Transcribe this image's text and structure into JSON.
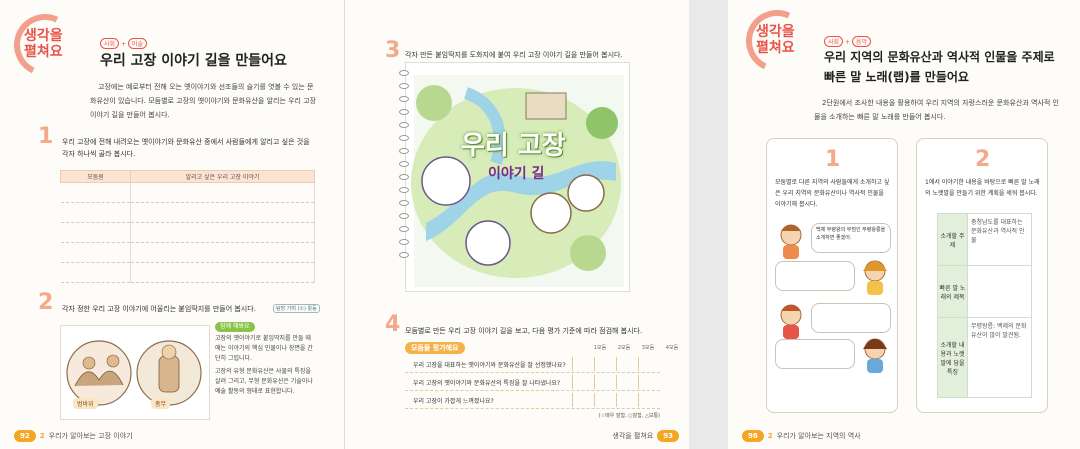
{
  "left_page": {
    "badge": "생각을\n펼쳐요",
    "subjects": [
      "사회",
      "미술"
    ],
    "title": "우리 고장 이야기 길을 만들어요",
    "intro": "고장에는 예로부터 전해 오는 옛이야기와 선조들의 슬기를 엿볼 수 있는 문화유산이 있습니다. 모둠별로 고장의 옛이야기와 문화유산을 알리는 우리 고장 이야기 길을 만들어 봅시다.",
    "step1_num": "1",
    "step1_text": "우리 고장에 전해 내려오는 옛이야기와 문화유산 중에서 사람들에게 알리고 싶은 것을 각자 하나씩 골라 봅시다.",
    "table_headers": [
      "모둠원",
      "알리고 싶은 우리 고장 이야기"
    ],
    "table_rows": 5,
    "step2_num": "2",
    "step2_text": "각자 정한 우리 고장 이야기에 어울리는 붙임딱지를 만들어 봅시다.",
    "step2_tag": "탐방 가며 (①) 활동",
    "stamp_labels": [
      "범바위",
      "총무"
    ],
    "note_title": "함께 해봐요",
    "note_items": [
      "고장의 옛이야기로 붙임딱지를 만들 때에는 이야기의 핵심 인물이나 장면을 간단히 그립니다.",
      "고장의 유형 문화유산은 사물의 특징을 살려 그리고, 무형 문화유산은 기술이나 예술 활동의 형태로 표현합니다."
    ],
    "footer_page": "92",
    "footer_unit": "2",
    "footer_text": "우리가 알아보는 고장 이야기"
  },
  "right_page": {
    "step3_num": "3",
    "step3_text": "각자 만든 붙임딱지를 도화지에 붙여 우리 고장 이야기 길을 만들어 봅시다.",
    "map_title": "우리 고장",
    "map_sub": "이야기 길",
    "step4_num": "4",
    "step4_text": "모둠별로 만든 우리 고장 이야기 길을 보고, 다음 평가 기준에 따라 점검해 봅시다.",
    "eval_label": "모둠들 평가해요",
    "eval_cols": [
      "1모둠",
      "2모둠",
      "3모둠",
      "4모둠"
    ],
    "eval_rows": [
      "우리 고장을 대표하는 옛이야기와 문화유산을 잘 선정했나요?",
      "우리 고장의 옛이야기와 문화유산의 특징을 잘 나타냈나요?",
      "우리 고장이 가깝게 느껴졌나요?"
    ],
    "eval_legend": "(☆매우 잘함, ○잘함, △보통)",
    "footer_text": "생각을 펼쳐요",
    "footer_page": "93"
  },
  "far_page": {
    "badge": "생각을\n펼쳐요",
    "subjects": [
      "사회",
      "음악"
    ],
    "title_line1": "우리 지역의 문화유산과 역사적 인물을 주제로",
    "title_line2": "빠른 말 노래(랩)를 만들어요",
    "intro": "2단원에서 조사한 내용을 활용하여 우리 지역의 자랑스러운 문화유산과 역사적 인물을 소개하는 빠른 말 노래를 만들어 봅시다.",
    "card1_num": "1",
    "card1_text": "모둠별로 다른 지역의 사람들에게 소개하고 싶은 우리 지역의 문화유산이나 역사적 인물을 이야기해 봅시다.",
    "card1_bubble": "백제 무령왕의 무덤인 무령왕릉을 소개하면 좋겠어.",
    "card2_num": "2",
    "card2_text": "1에서 이야기한 내용을 바탕으로 빠른 말 노래의 노랫말을 만들기 위한 계획을 세워 봅시다.",
    "plan_rows": [
      {
        "h": "소개할 주제",
        "v": "충청남도를 대표하는 문화유산과 역사적 인물"
      },
      {
        "h": "빠른 말 노래의 제목",
        "v": ""
      },
      {
        "h": "소개할 내용과 노랫말에 담을 특징",
        "v": "무령왕릉: 백제의 문화유산이 많이 발견됨."
      }
    ],
    "footer_page": "98",
    "footer_unit": "2",
    "footer_text": "우리가 알아보는 지역의 역사"
  },
  "colors": {
    "accent": "#e8544a",
    "orange": "#f5a623",
    "peach": "#f4a98a"
  }
}
